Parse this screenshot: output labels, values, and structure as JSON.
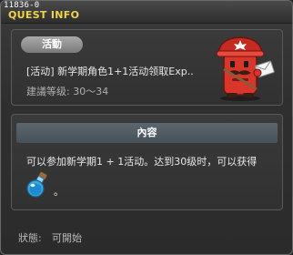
{
  "window": {
    "quest_id": "11836-0",
    "title": "QUEST INFO"
  },
  "quest": {
    "category": "活動",
    "name": "[活动] 新学期角色1+1活动领取Exp..",
    "level_requirement": "建議等级: 30～34"
  },
  "content": {
    "header": "內容",
    "description": "可以参加新学期1 + 1活动。达到30级时，可以获得",
    "after_item": "。"
  },
  "status": {
    "label": "狀態:",
    "value": "可開始"
  },
  "colors": {
    "title": "#f1d34a",
    "badge": "#8f8f8f",
    "header_bar": "#515c66",
    "npc_red": "#d8352b"
  },
  "icons": {
    "npc": "red-mailbox-npc",
    "reward_item": "blue-potion-icon"
  }
}
